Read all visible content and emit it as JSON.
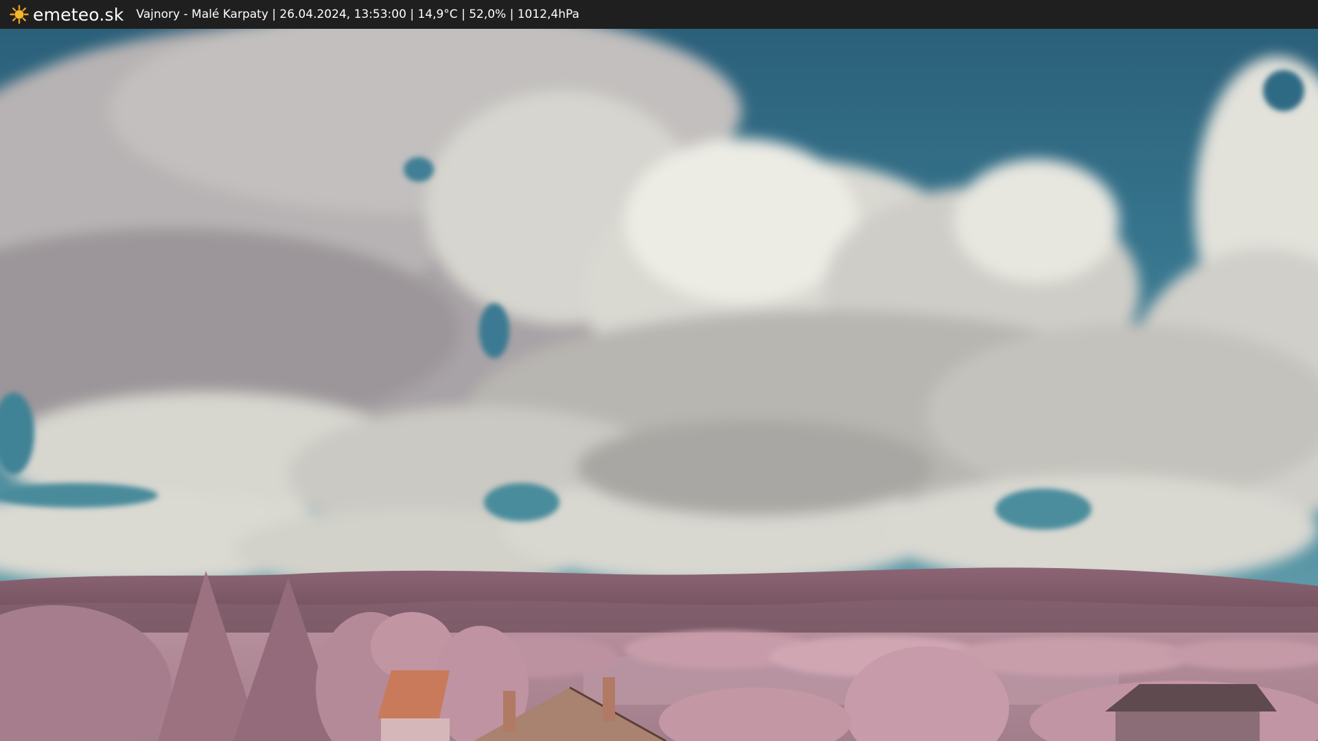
{
  "header": {
    "logo_icon": "sun-icon",
    "brand": "emeteo.sk",
    "caption": "Vajnory - Malé Karpaty | 26.04.2024, 13:53:00 | 14,9°C | 52,0% | 1012,4hPa"
  },
  "colors": {
    "bar_background": "#1f1f1f",
    "sky": "#2f6a83",
    "vegetation": "#c89aa8",
    "hills": "#7a5562",
    "roof": "#c97a5a"
  }
}
